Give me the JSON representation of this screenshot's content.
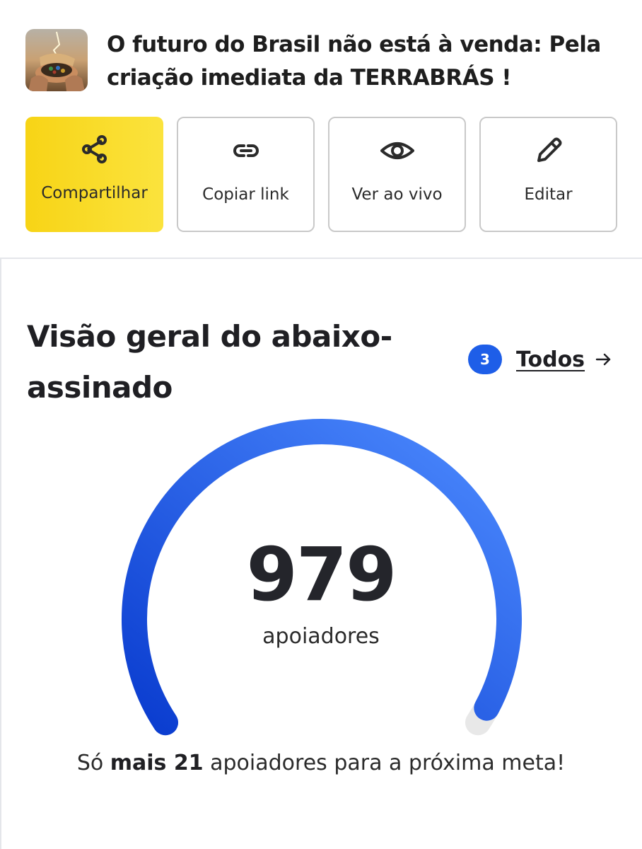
{
  "header": {
    "petition_title": "O futuro do Brasil não está à venda: Pela criação imediata da TERRABRÁS !",
    "thumbnail_icon": "petition-thumbnail"
  },
  "actions": [
    {
      "label": "Compartilhar",
      "icon": "share-icon"
    },
    {
      "label": "Copiar link",
      "icon": "link-icon"
    },
    {
      "label": "Ver ao vivo",
      "icon": "eye-icon"
    },
    {
      "label": "Editar",
      "icon": "pencil-icon"
    }
  ],
  "overview": {
    "title": "Visão geral do abaixo-assinado",
    "updates_count": "3",
    "all_link": "Todos"
  },
  "progress": {
    "supporters": "979",
    "supporters_label": "apoiadores",
    "goal_fraction": 0.979,
    "msg_prefix": "Só ",
    "msg_bold": "mais 21",
    "msg_suffix": " apoiadores para a próxima meta!"
  },
  "colors": {
    "primary_button": "#f7d416",
    "accent_blue": "#1e5ee8",
    "gauge_start": "#0a3ccf",
    "gauge_end": "#4d8bff",
    "gauge_track": "#e8e8e8"
  }
}
